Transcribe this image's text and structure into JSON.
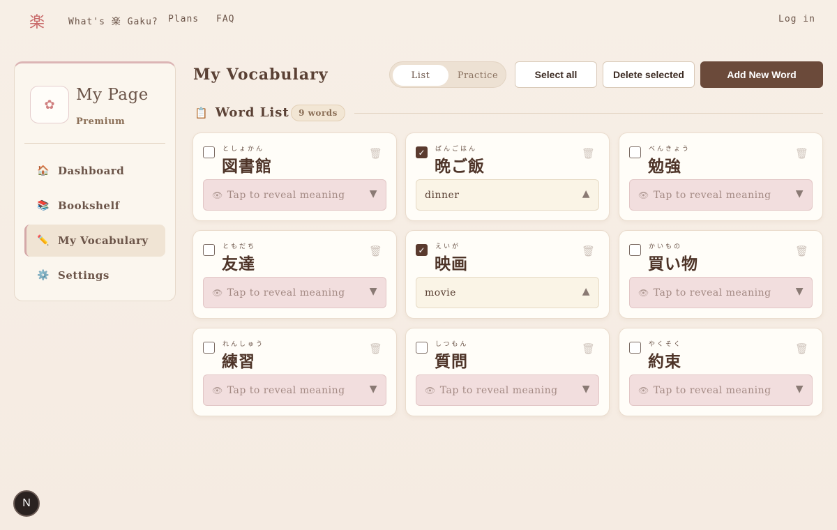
{
  "nav": {
    "logo": "楽",
    "whats": "What's 楽 Gaku?",
    "plans": "Plans",
    "faq": "FAQ",
    "login": "Log in"
  },
  "sidebar": {
    "profile_icon": "✿",
    "title": "My Page",
    "plan": "Premium",
    "items": [
      {
        "icon": "🏠",
        "label": "Dashboard"
      },
      {
        "icon": "📚",
        "label": "Bookshelf"
      },
      {
        "icon": "✏️",
        "label": "My Vocabulary"
      },
      {
        "icon": "⚙️",
        "label": "Settings"
      }
    ]
  },
  "header": {
    "title": "My Vocabulary",
    "toggle_list": "List",
    "toggle_practice": "Practice",
    "select_all": "Select all",
    "delete_selected": "Delete selected",
    "add_new": "Add New Word"
  },
  "section": {
    "icon": "📋",
    "title": "Word List",
    "count": "9 words"
  },
  "hidden_label": "Tap to reveal meaning",
  "cards": [
    {
      "reading": "としょかん",
      "word": "図書館",
      "checked": false,
      "meaning": ""
    },
    {
      "reading": "ばんごはん",
      "word": "晩ご飯",
      "checked": true,
      "meaning": "dinner"
    },
    {
      "reading": "べんきょう",
      "word": "勉強",
      "checked": false,
      "meaning": ""
    },
    {
      "reading": "ともだち",
      "word": "友達",
      "checked": false,
      "meaning": ""
    },
    {
      "reading": "えいが",
      "word": "映画",
      "checked": true,
      "meaning": "movie"
    },
    {
      "reading": "かいもの",
      "word": "買い物",
      "checked": false,
      "meaning": ""
    },
    {
      "reading": "れんしゅう",
      "word": "練習",
      "checked": false,
      "meaning": ""
    },
    {
      "reading": "しつもん",
      "word": "質問",
      "checked": false,
      "meaning": ""
    },
    {
      "reading": "やくそく",
      "word": "約束",
      "checked": false,
      "meaning": ""
    }
  ],
  "fab": "N"
}
